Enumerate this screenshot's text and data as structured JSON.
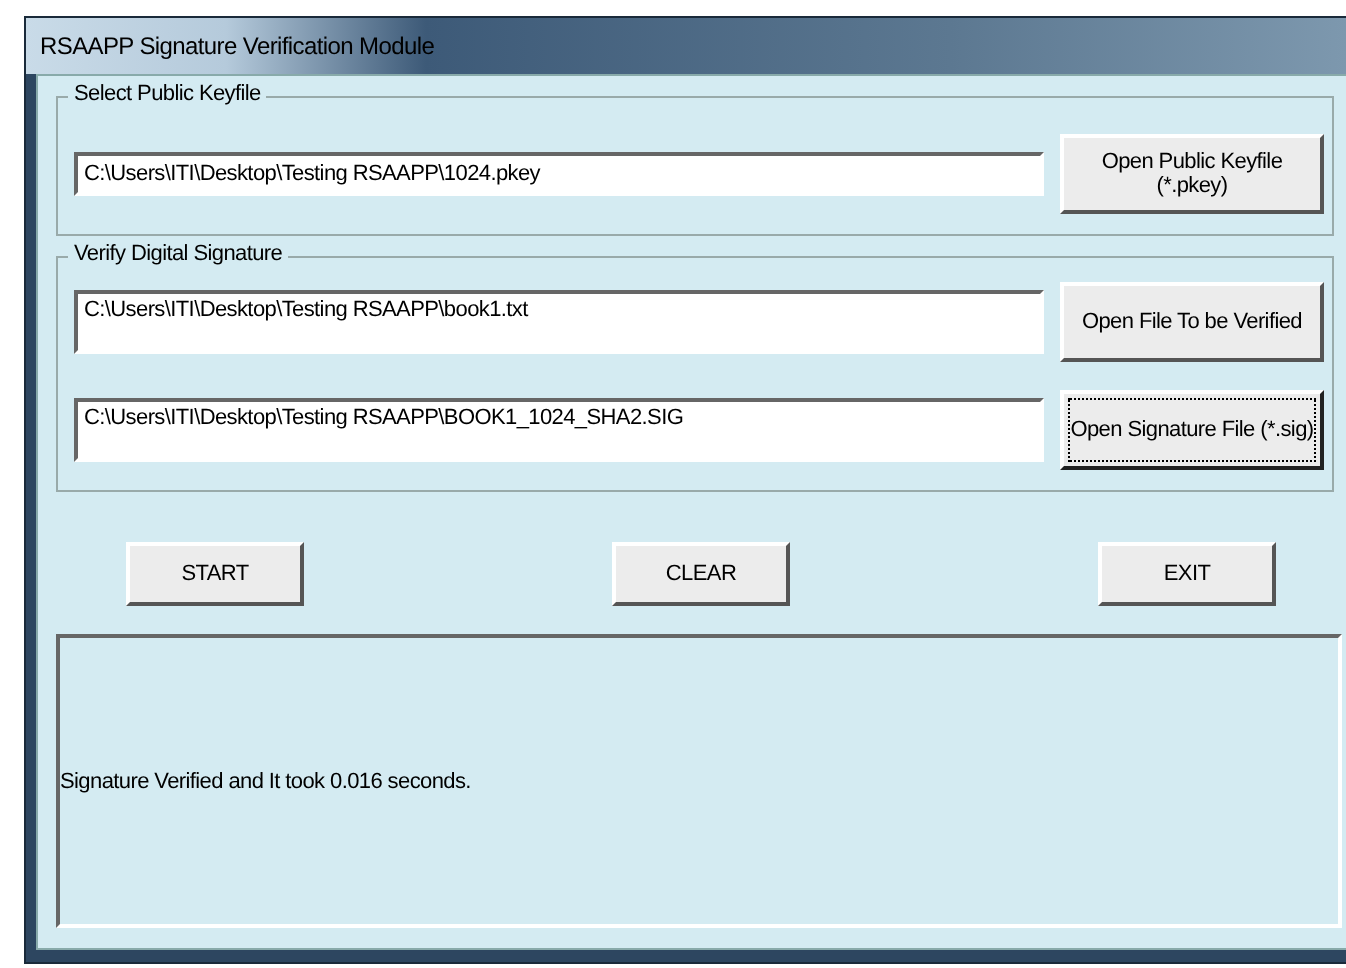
{
  "window": {
    "title": "RSAAPP Signature Verification Module"
  },
  "groups": [
    {
      "title": "Select Public Keyfile",
      "rows": [
        {
          "value": "C:\\Users\\ITI\\Desktop\\Testing RSAAPP\\1024.pkey",
          "button": [
            "Open Public Keyfile",
            "(*.pkey)"
          ],
          "focused": false
        }
      ]
    },
    {
      "title": "Verify Digital Signature",
      "rows": [
        {
          "value": "C:\\Users\\ITI\\Desktop\\Testing RSAAPP\\book1.txt",
          "button": [
            "Open File To be Verified"
          ],
          "focused": false
        },
        {
          "value": "C:\\Users\\ITI\\Desktop\\Testing RSAAPP\\BOOK1_1024_SHA2.SIG",
          "button": [
            "Open Signature File (*.sig)"
          ],
          "focused": true
        }
      ]
    }
  ],
  "buttons": [
    "START",
    "CLEAR",
    "EXIT"
  ],
  "output": "Signature Verified and It took 0.016 seconds."
}
